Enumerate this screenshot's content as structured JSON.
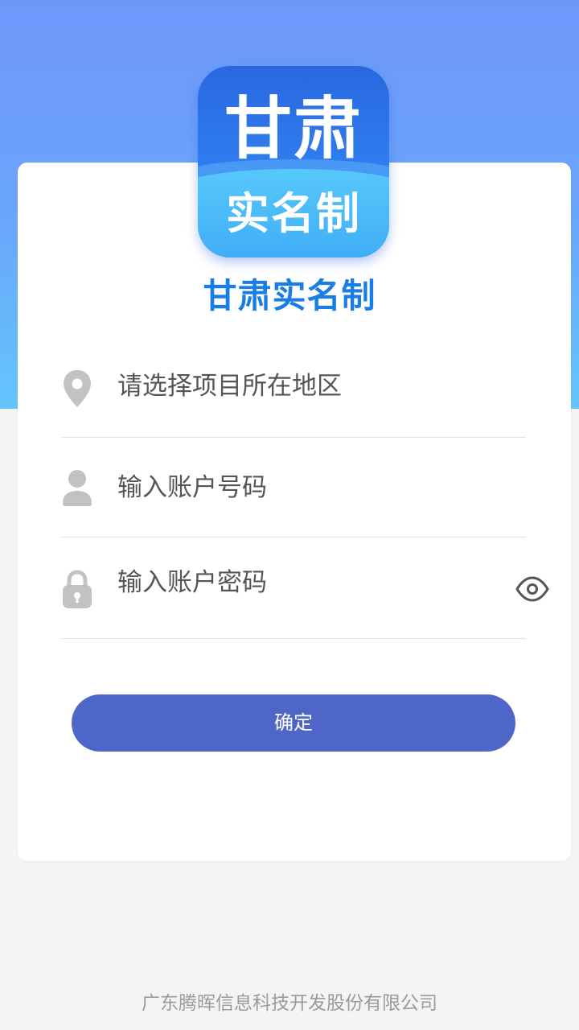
{
  "logo": {
    "line1": "甘肃",
    "line2": "实名制"
  },
  "app_title": "甘肃实名制",
  "fields": {
    "region": {
      "placeholder": "请选择项目所在地区",
      "icon": "location-pin-icon"
    },
    "account": {
      "placeholder": "输入账户号码",
      "icon": "user-icon"
    },
    "password": {
      "placeholder": "输入账户密码",
      "icon": "lock-icon",
      "toggle_icon": "eye-icon"
    }
  },
  "confirm_label": "确定",
  "footer": "广东腾晖信息科技开发股份有限公司",
  "colors": {
    "header_gradient_top": "#6f97fb",
    "header_gradient_bottom": "#64c6fb",
    "title": "#1a7de6",
    "button": "#4d66c8",
    "icon_gray": "#c2c2c2"
  }
}
